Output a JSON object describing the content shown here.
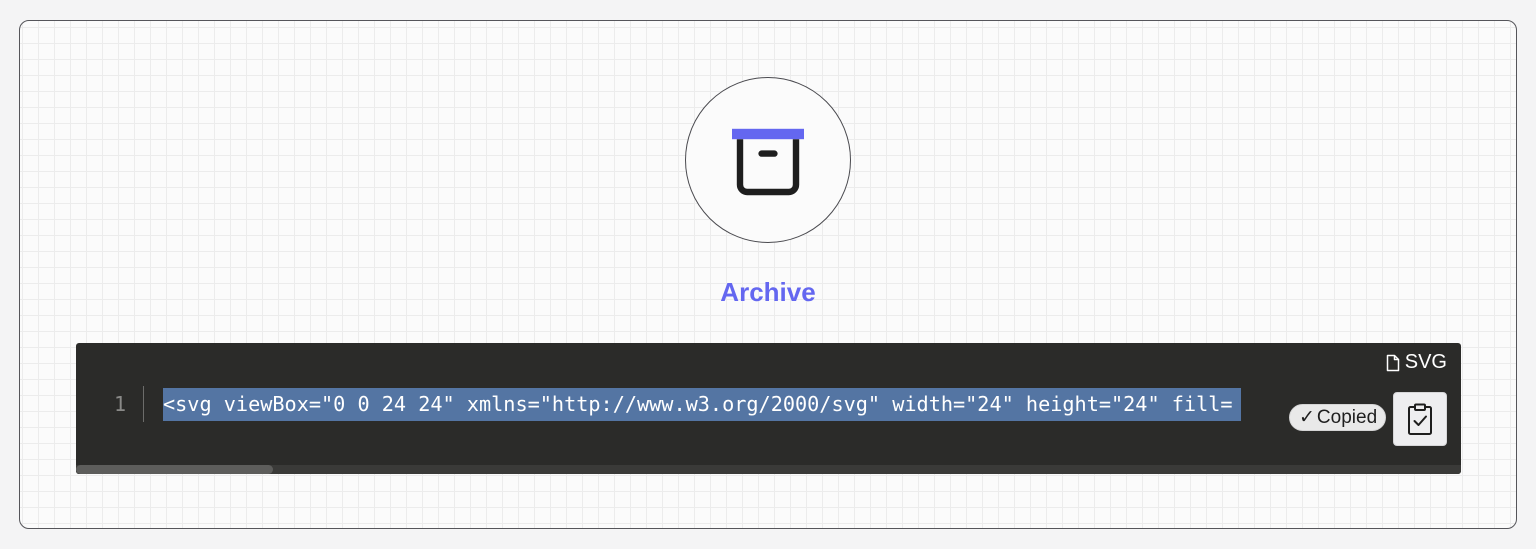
{
  "icon": {
    "name": "Archive",
    "semantic": "archive-icon",
    "accent_color": "#6467f0",
    "stroke_color": "#1e1e1e"
  },
  "code": {
    "language_label": "SVG",
    "language_icon": "file-icon",
    "line_number": "1",
    "line_text": "<svg viewBox=\"0 0 24 24\" xmlns=\"http://www.w3.org/2000/svg\" width=\"24\" height=\"24\" fill=",
    "selection_color": "#5475a3",
    "background_color": "#2b2b29"
  },
  "copy": {
    "status_label": "Copied",
    "status_icon": "checkmark-icon",
    "button_icon": "clipboard-check-icon"
  }
}
